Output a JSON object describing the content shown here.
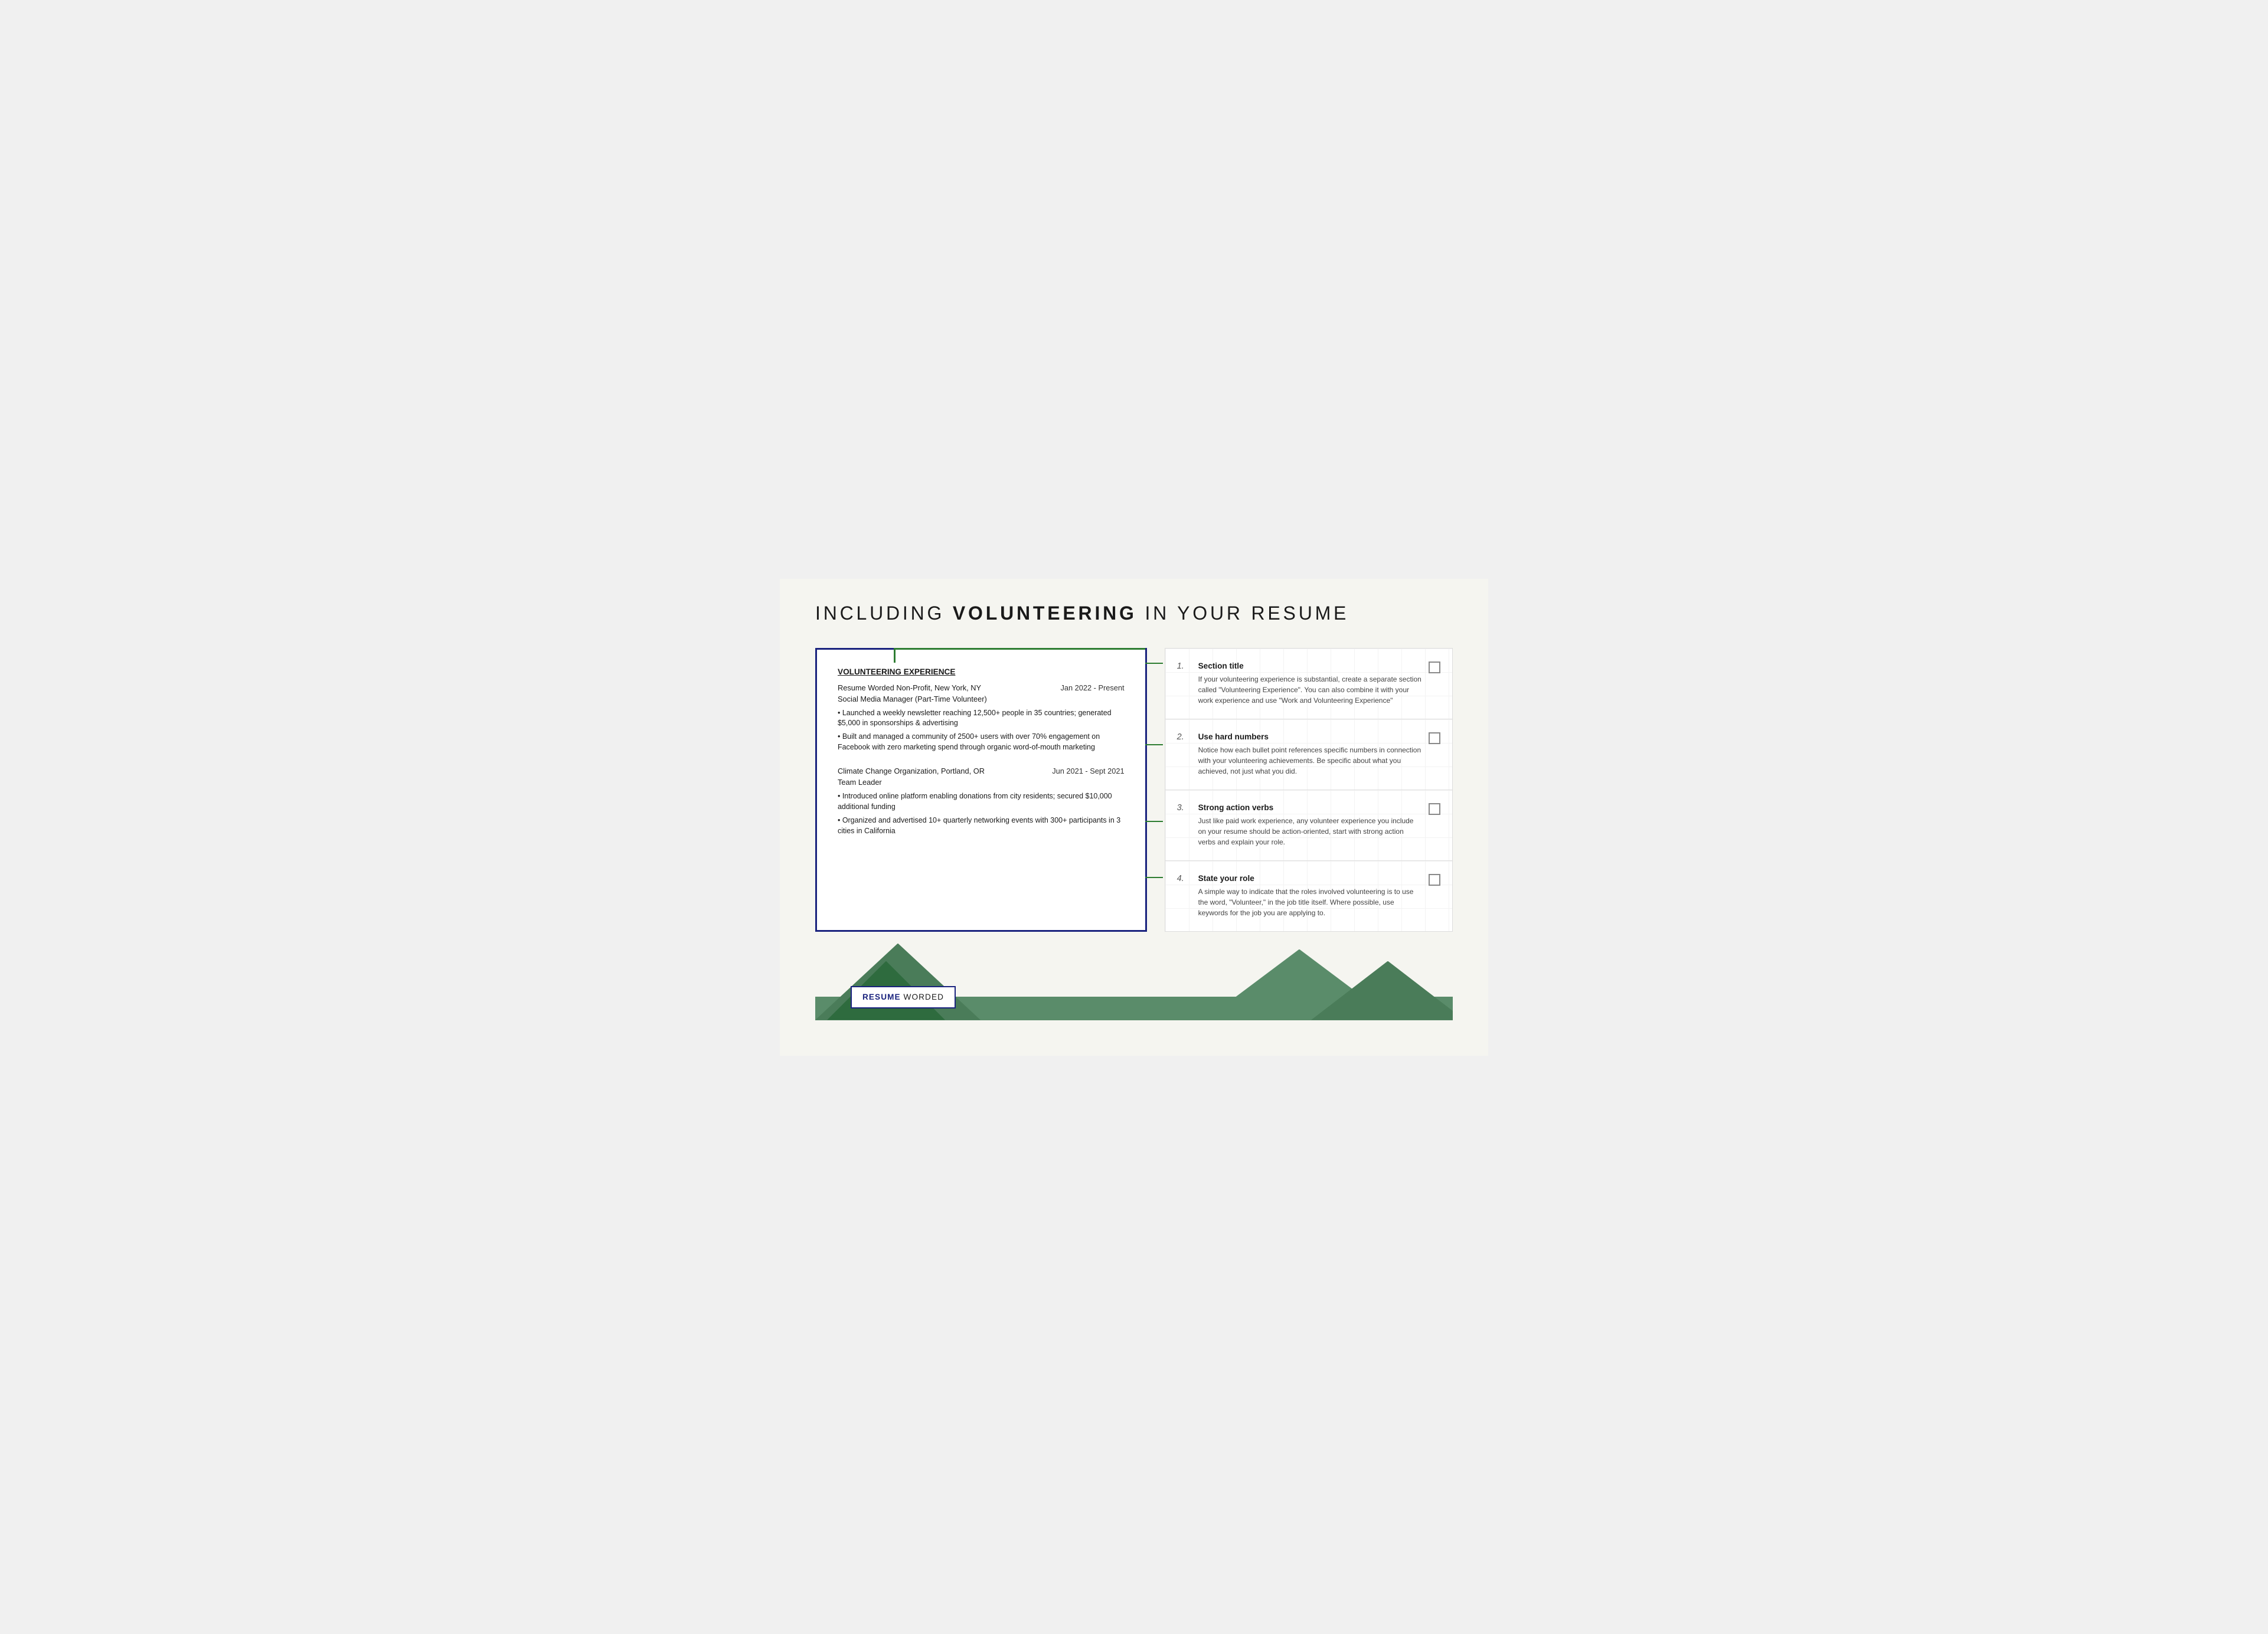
{
  "page": {
    "title_prefix": "INCLUDING ",
    "title_bold": "VOLUNTEERING",
    "title_suffix": " IN YOUR RESUME"
  },
  "resume": {
    "section_title": "VOLUNTEERING EXPERIENCE",
    "entries": [
      {
        "org": "Resume Worded Non-Profit, New York, NY",
        "date": "Jan 2022 - Present",
        "role": "Social Media Manager (Part-Time Volunteer)",
        "bullets": [
          "• Launched a weekly newsletter reaching 12,500+ people in 35 countries; generated $5,000 in sponsorships & advertising",
          "• Built and managed a community of 2500+ users with over 70% engagement on Facebook with zero marketing spend through organic word-of-mouth marketing"
        ]
      },
      {
        "org": "Climate Change Organization, Portland, OR",
        "date": "Jun 2021 - Sept 2021",
        "role": "Team Leader",
        "bullets": [
          "• Introduced online platform enabling donations from city residents; secured $10,000 additional funding",
          "• Organized and advertised 10+ quarterly networking events with 300+ participants in 3 cities in California"
        ]
      }
    ]
  },
  "tips": [
    {
      "number": "1.",
      "title": "Section title",
      "description": "If your volunteering experience is substantial, create a separate section called \"Volunteering Experience\". You can also combine it with your work experience and use \"Work and Volunteering Experience\""
    },
    {
      "number": "2.",
      "title": "Use hard numbers",
      "description": "Notice how each bullet point references specific numbers in connection with your volunteering achievements. Be specific about what you achieved, not just what you did."
    },
    {
      "number": "3.",
      "title": "Strong action verbs",
      "description": "Just like paid work experience, any volunteer experience you include on your resume should be action-oriented, start with strong action verbs and explain your role."
    },
    {
      "number": "4.",
      "title": "State your role",
      "description": "A simple way to indicate that the roles involved volunteering is to use the word, \"Volunteer,\" in the job title itself. Where possible, use keywords for the job you are applying to."
    }
  ],
  "logo": {
    "bold_part": "RESUME",
    "regular_part": " WORDED"
  }
}
